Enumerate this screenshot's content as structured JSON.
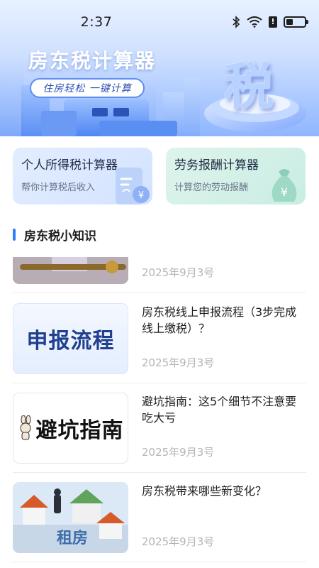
{
  "status_bar": {
    "time": "2:37"
  },
  "hero": {
    "title": "房东税计算器",
    "tagline": "住房轻松 一键计算",
    "emblem": "税"
  },
  "calculators": [
    {
      "title": "个人所得税计算器",
      "subtitle": "帮你计算税后收入",
      "icon": "tax-receipt-icon"
    },
    {
      "title": "劳务报酬计算器",
      "subtitle": "计算您的劳动报酬",
      "icon": "money-bag-icon"
    }
  ],
  "section": {
    "title": "房东税小知识"
  },
  "articles": [
    {
      "title": "",
      "date": "2025年9月3号",
      "thumb_text": ""
    },
    {
      "title": "房东税线上申报流程（3步完成线上缴税）？",
      "date": "2025年9月3号",
      "thumb_text": "申报流程"
    },
    {
      "title": "避坑指南：这5个细节不注意要吃大亏",
      "date": "2025年9月3号",
      "thumb_text": "避坑指南"
    },
    {
      "title": "房东税带来哪些新变化？",
      "date": "2025年9月3号",
      "thumb_text": "租房"
    }
  ],
  "colors": {
    "accent": "#2f7ff5",
    "hero_top": "#e8f1ff",
    "hero_bottom": "#8fb6ff"
  }
}
